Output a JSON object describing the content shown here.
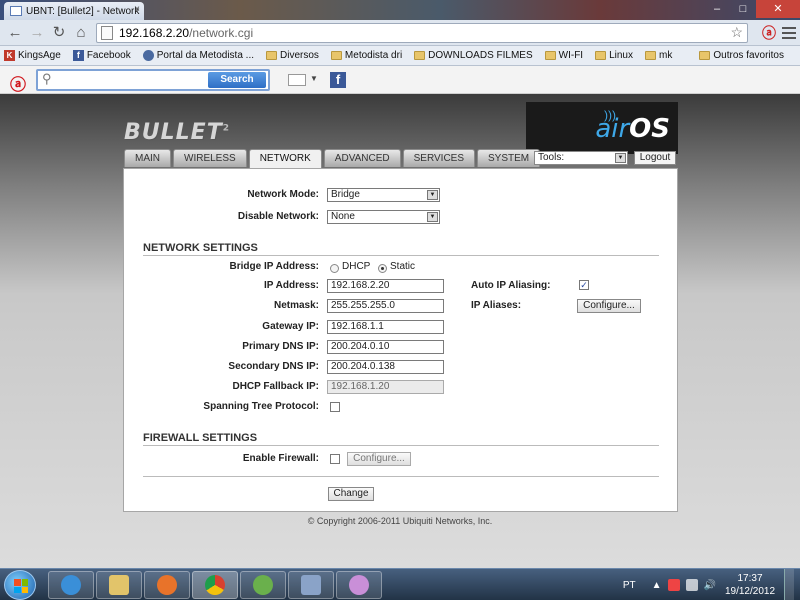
{
  "browser": {
    "tab_title": "UBNT: [Bullet2] - Network",
    "tab_close": "×",
    "url_host": "192.168.2.20",
    "url_path": "/network.cgi",
    "window_buttons": [
      "–",
      "□",
      "✕"
    ]
  },
  "bookmarks": {
    "items": [
      {
        "label": "KingsAge",
        "icon": "kingsage-icon"
      },
      {
        "label": "Facebook",
        "icon": "facebook-icon"
      },
      {
        "label": "Portal da Metodista ...",
        "icon": "portal-icon"
      },
      {
        "label": "Diversos",
        "icon": "folder-icon"
      },
      {
        "label": "Metodista dri",
        "icon": "folder-icon"
      },
      {
        "label": "DOWNLOADS FILMES",
        "icon": "folder-icon"
      },
      {
        "label": "WI-FI",
        "icon": "folder-icon"
      },
      {
        "label": "Linux",
        "icon": "folder-icon"
      },
      {
        "label": "mk",
        "icon": "folder-icon"
      }
    ],
    "more": "»",
    "other": "Outros favoritos"
  },
  "avira": {
    "search_button": "Search",
    "search_value": ""
  },
  "app": {
    "product": "BULLET",
    "product_version": "2",
    "os_logo_air": "air",
    "os_logo_os": "OS",
    "tabs": [
      {
        "label": "MAIN",
        "active": false
      },
      {
        "label": "WIRELESS",
        "active": false
      },
      {
        "label": "NETWORK",
        "active": true
      },
      {
        "label": "ADVANCED",
        "active": false
      },
      {
        "label": "SERVICES",
        "active": false
      },
      {
        "label": "SYSTEM",
        "active": false
      }
    ],
    "tools_value": "Tools:",
    "logout_label": "Logout"
  },
  "form": {
    "network_mode": {
      "label": "Network Mode:",
      "value": "Bridge"
    },
    "disable_network": {
      "label": "Disable Network:",
      "value": "None"
    },
    "network_settings_title": "NETWORK SETTINGS",
    "bridge_ip": {
      "label": "Bridge IP Address:",
      "dhcp": "DHCP",
      "static": "Static",
      "selected": "Static"
    },
    "ip_address": {
      "label": "IP Address:",
      "value": "192.168.2.20"
    },
    "netmask": {
      "label": "Netmask:",
      "value": "255.255.255.0"
    },
    "gateway": {
      "label": "Gateway IP:",
      "value": "192.168.1.1"
    },
    "primary_dns": {
      "label": "Primary DNS IP:",
      "value": "200.204.0.10"
    },
    "secondary_dns": {
      "label": "Secondary DNS IP:",
      "value": "200.204.0.138"
    },
    "dhcp_fallback": {
      "label": "DHCP Fallback IP:",
      "value": "192.168.1.20"
    },
    "stp": {
      "label": "Spanning Tree Protocol:",
      "checked": false
    },
    "auto_ip_aliasing": {
      "label": "Auto IP Aliasing:",
      "checked": true,
      "mark": "✓"
    },
    "ip_aliases": {
      "label": "IP Aliases:",
      "button": "Configure..."
    },
    "firewall_settings_title": "FIREWALL SETTINGS",
    "enable_firewall": {
      "label": "Enable Firewall:",
      "checked": false,
      "button": "Configure..."
    },
    "change_button": "Change"
  },
  "footer": {
    "copyright": "© Copyright 2006-2011 Ubiquiti Networks, Inc."
  },
  "taskbar": {
    "language": "PT",
    "time": "17:37",
    "date": "19/12/2012",
    "pinned": [
      {
        "name": "internet-explorer-icon",
        "color": "#3a8fd8"
      },
      {
        "name": "file-explorer-icon",
        "color": "#e2c46a"
      },
      {
        "name": "media-player-icon",
        "color": "#e8732a"
      },
      {
        "name": "chrome-icon",
        "color": "#d8402f"
      },
      {
        "name": "network-users-icon",
        "color": "#6ab04c"
      },
      {
        "name": "remote-desktop-icon",
        "color": "#8aa3c8"
      },
      {
        "name": "paint-icon",
        "color": "#c98fd8"
      }
    ]
  },
  "colors": {
    "accent_blue": "#3ea8e8",
    "avira_red": "#d0151b"
  }
}
